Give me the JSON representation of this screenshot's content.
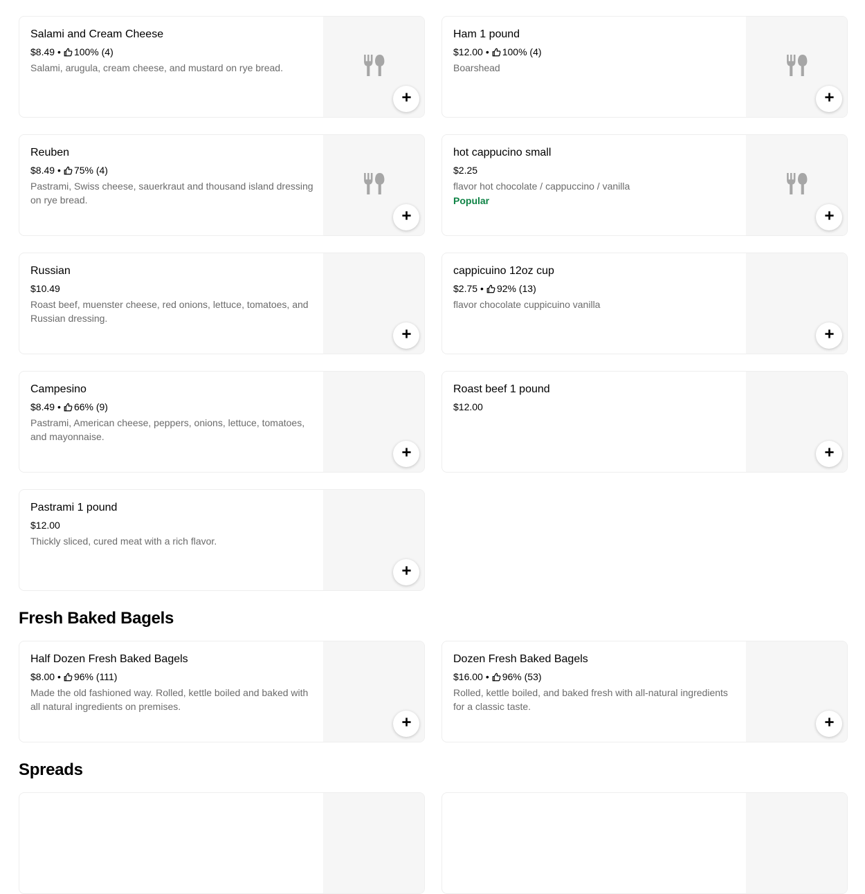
{
  "menu_section_1": {
    "items": [
      {
        "title": "Salami and Cream Cheese",
        "price": "$8.49",
        "rating": "100% (4)",
        "description": "Salami, arugula, cream cheese, and mustard on rye bread."
      },
      {
        "title": "Ham 1 pound",
        "price": "$12.00",
        "rating": "100% (4)",
        "description": "Boarshead"
      },
      {
        "title": "Reuben",
        "price": "$8.49",
        "rating": "75% (4)",
        "description": "Pastrami, Swiss cheese, sauerkraut and thousand island dressing on rye bread."
      },
      {
        "title": "hot cappucino small",
        "price": "$2.25",
        "description": "flavor hot chocolate / cappuccino / vanilla",
        "badge": "Popular"
      },
      {
        "title": "Russian",
        "price": "$10.49",
        "description": "Roast beef, muenster cheese, red onions, lettuce, tomatoes, and Russian dressing."
      },
      {
        "title": "cappicuino 12oz cup",
        "price": "$2.75",
        "rating": "92% (13)",
        "description": "flavor chocolate cuppicuino vanilla"
      },
      {
        "title": "Campesino",
        "price": "$8.49",
        "rating": "66% (9)",
        "description": "Pastrami, American cheese, peppers, onions, lettuce, tomatoes, and mayonnaise."
      },
      {
        "title": "Roast beef 1 pound",
        "price": "$12.00"
      },
      {
        "title": "Pastrami 1 pound",
        "price": "$12.00",
        "description": "Thickly sliced, cured meat with a rich flavor."
      }
    ]
  },
  "section_bagels": {
    "heading": "Fresh Baked Bagels",
    "items": [
      {
        "title": "Half Dozen Fresh Baked Bagels",
        "price": "$8.00",
        "rating": "96% (111)",
        "description": "Made the old fashioned way. Rolled, kettle boiled and baked with all natural ingredients on premises."
      },
      {
        "title": "Dozen Fresh Baked Bagels",
        "price": "$16.00",
        "rating": "96% (53)",
        "description": "Rolled, kettle boiled, and baked fresh with all-natural ingredients for a classic taste."
      }
    ]
  },
  "section_spreads": {
    "heading": "Spreads"
  },
  "icons": {
    "placeholder": "fork-knife-icon",
    "add": "plus-icon",
    "rating": "thumbs-up-icon"
  },
  "colors": {
    "popular_badge": "#0e8345",
    "description_text": "#6b6b6b",
    "image_placeholder_bg": "#f6f6f6",
    "placeholder_icon": "#a6a6a6"
  }
}
